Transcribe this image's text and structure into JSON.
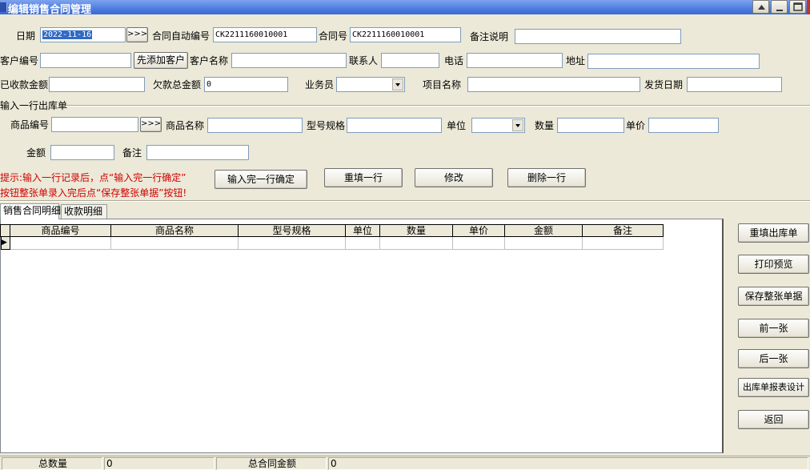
{
  "window": {
    "title": "编辑销售合同管理"
  },
  "header": {
    "date_label": "日期",
    "date_value": "2022-11-16",
    "date_picker_label": ">>>",
    "contract_auto_no_label": "合同自动编号",
    "contract_auto_no_value": "CK2211160010001",
    "contract_no_label": "合同号",
    "contract_no_value": "CK2211160010001",
    "remark_label": "备注说明",
    "remark_value": "",
    "customer_no_label": "客户编号",
    "customer_no_value": "",
    "add_customer_label": "先添加客户",
    "customer_name_label": "客户名称",
    "customer_name_value": "",
    "contact_label": "联系人",
    "contact_value": "",
    "phone_label": "电话",
    "phone_value": "",
    "address_label": "地址",
    "address_value": "",
    "received_label": "已收款金额",
    "received_value": "",
    "owed_label": "欠款总金额",
    "owed_value": "0",
    "salesman_label": "业务员",
    "salesman_value": "",
    "project_label": "项目名称",
    "project_value": "",
    "ship_date_label": "发货日期",
    "ship_date_value": ""
  },
  "line_entry": {
    "section_title": "输入一行出库单",
    "product_no_label": "商品编号",
    "product_no_value": "",
    "product_picker_label": ">>>",
    "product_name_label": "商品名称",
    "product_name_value": "",
    "spec_label": "型号规格",
    "spec_value": "",
    "unit_label": "单位",
    "unit_value": "",
    "qty_label": "数量",
    "qty_value": "",
    "price_label": "单价",
    "price_value": "",
    "amount_label": "金额",
    "amount_value": "",
    "note_label": "备注",
    "note_value": "",
    "hint_line1": "提示:输入一行记录后，点“输入完一行确定”",
    "hint_line2": "按钮整张单录入完后点“保存整张单据”按钮!",
    "confirm_row_label": "输入完一行确定",
    "refill_row_label": "重填一行",
    "modify_label": "修改",
    "delete_row_label": "删除一行"
  },
  "tabs": [
    {
      "label": "销售合同明细"
    },
    {
      "label": "收款明细"
    }
  ],
  "grid": {
    "columns": [
      "商品编号",
      "商品名称",
      "型号规格",
      "单位",
      "数量",
      "单价",
      "金额",
      "备注"
    ],
    "row_indicator": "▶"
  },
  "side_buttons": [
    "重填出库单",
    "打印预览",
    "保存整张单据",
    "前一张",
    "后一张",
    "出库单报表设计",
    "返回"
  ],
  "status": {
    "total_qty_label": "总数量",
    "total_qty_value": "0",
    "total_amount_label": "总合同金额",
    "total_amount_value": "0"
  },
  "colors": {
    "title_bar": "#4d7de0",
    "hint_text": "#d10000",
    "selection": "#316ac5"
  }
}
